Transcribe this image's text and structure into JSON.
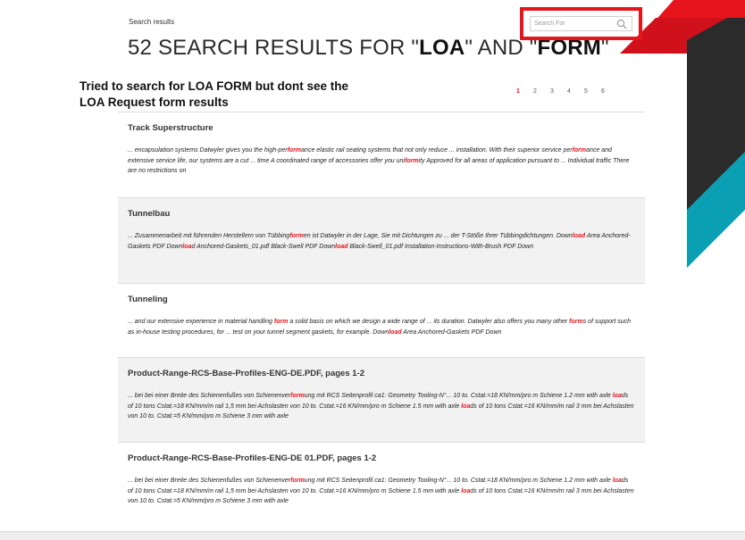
{
  "breadcrumb": "Search results",
  "search": {
    "placeholder": "Search For"
  },
  "title": {
    "prefix": "52 SEARCH RESULTS FOR \"",
    "term1": "LOA",
    "middle": "\" AND \"",
    "term2": "FORM",
    "suffix": "\""
  },
  "annotation": "Tried to search for LOA  FORM but dont see the LOA Request form results",
  "pagination": [
    "1",
    "2",
    "3",
    "4",
    "5",
    "6"
  ],
  "pagination_active": "1",
  "colors": {
    "highlight": "#e8141c",
    "teal": "#0b9fb3",
    "dark": "#2d2d2d",
    "red": "#e8141c"
  },
  "results": [
    {
      "title": "Track Superstructure",
      "snippet": [
        "... encapsulation systems Datwyler gives you the high-per",
        {
          "hl": "form"
        },
        "ance elastic rail seating systems that not only reduce ... installation.  With their superior service per",
        {
          "hl": "form"
        },
        "ance and extensive service life, our systems are a cut ... time A coordinated range of accessories offer you uni",
        {
          "hl": "form"
        },
        "ity  Approved for all areas of application pursuant to ... Individual traffic There are no restrictions on"
      ]
    },
    {
      "title": "Tunnelbau",
      "snippet": [
        "... Zusammenarbeit mit führenden Herstellern von Tübbing",
        {
          "hl": "form"
        },
        "en ist Datwyler in der Lage, Sie mit Dichtungen zu ... der T-Stöße Ihrer Tübbingdichtungen. Down",
        {
          "hl": "load"
        },
        " Area Anchored-Gaskets PDF Down",
        {
          "hl": "loa"
        },
        "d Anchored-Gaskets_01.pdf Black-Swell PDF Down",
        {
          "hl": "load"
        },
        " Black-Swell_01.pdf Installation-Instructions-With-Brush PDF Down"
      ]
    },
    {
      "title": "Tunneling",
      "snippet": [
        "... and our extensive experience in material handling ",
        {
          "hl": "form"
        },
        " a solid basis on which we design a wide range of ... its duration.  Datwyler also offers you many other ",
        {
          "hl": "form"
        },
        "s of support such as in-house testing procedures, for ... test on your tunnel segment gaskets, for example. Down",
        {
          "hl": "load"
        },
        " Area Anchored-Gaskets PDF Down"
      ]
    },
    {
      "title": "Product-Range-RCS-Base-Profiles-ENG-DE.PDF, pages 1-2",
      "snippet": [
        "... bei bei einer Breite des Schienenfußes von Schienenver",
        {
          "hl": "form"
        },
        "ung mit RCS Seitenprofil ca1: Geometry Tooling-N°... 10 to. Cstat.=18 KN/mm/pro m Schiene 1.2 mm with axle ",
        {
          "hl": "loa"
        },
        "ds of 10 tons Cstat.=18 KN/mm/m rail 1,5 mm bei Achslasten von 10 to. Cstat.=16 KN/mm/pro m Schiene 1.5 mm with axle ",
        {
          "hl": "loa"
        },
        "ds of 10 tons Cstat.=16 KN/mm/m rail 3 mm bei Achslasten von 10 to. Cstat.=5 KN/mm/pro m Schiene 3 mm with axle"
      ]
    },
    {
      "title": "Product-Range-RCS-Base-Profiles-ENG-DE 01.PDF, pages 1-2",
      "snippet": [
        "... bei bei einer Breite des Schienenfußes von Schienenver",
        {
          "hl": "form"
        },
        "ung mit RCS Seitenprofil ca1: Geometry Tooling-N°... 10 to. Cstat.=18 KN/mm/pro m Schiene 1.2 mm with axle ",
        {
          "hl": "loa"
        },
        "ds of 10 tons Cstat.=18 KN/mm/m rail 1,5 mm bei Achslasten von 10 to. Cstat.=16 KN/mm/pro m Schiene 1.5 mm with axle ",
        {
          "hl": "loa"
        },
        "ds of 10 tons Cstat.=16 KN/mm/m rail 3 mm bei Achslasten von 10 to. Cstat.=5 KN/mm/pro m Schiene 3 mm with axle"
      ]
    }
  ]
}
